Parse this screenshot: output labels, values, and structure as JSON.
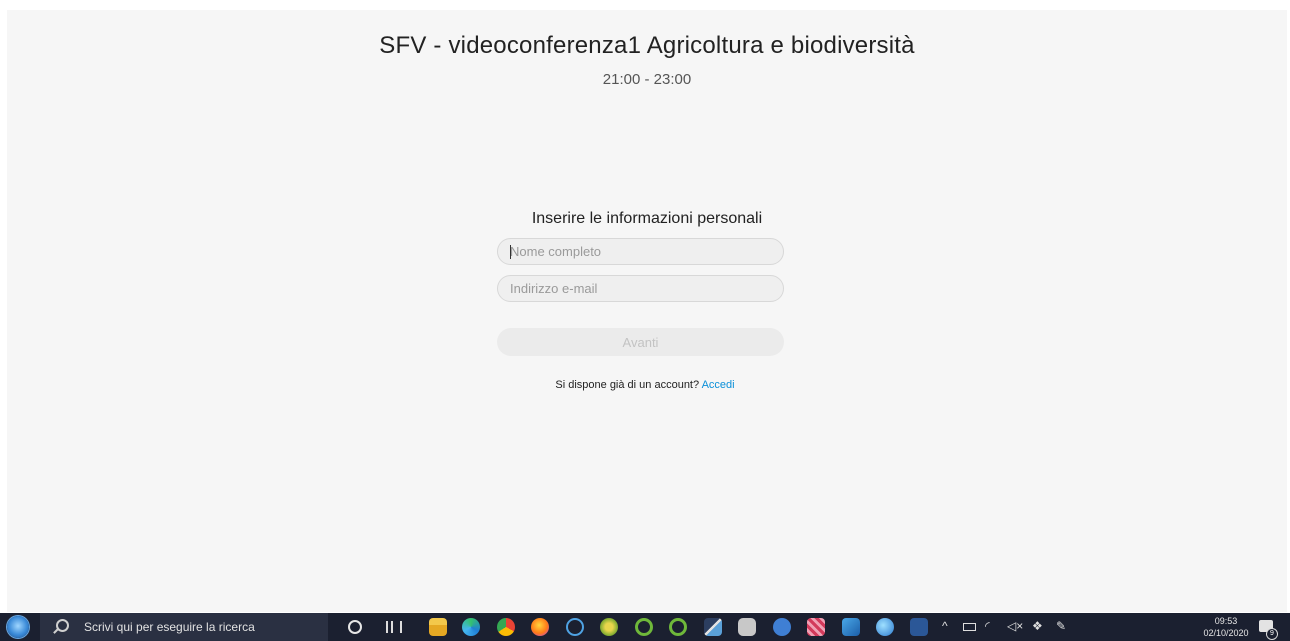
{
  "meeting": {
    "title": "SFV - videoconferenza1 Agricoltura e biodiversità",
    "time": "21:00 - 23:00"
  },
  "form": {
    "heading": "Inserire le informazioni personali",
    "name_placeholder": "Nome completo",
    "name_value": "",
    "email_placeholder": "Indirizzo e-mail",
    "email_value": "",
    "next_label": "Avanti",
    "account_prompt": "Si dispone già di un account?",
    "signin_link": "Accedi"
  },
  "taskbar": {
    "search_placeholder": "Scrivi qui per eseguire la ricerca",
    "pinned_icons": [
      "file-explorer-icon",
      "edge-icon",
      "chrome-icon",
      "firefox-icon",
      "network-icon",
      "qgis-icon",
      "qgis-icon-2",
      "qgis-icon-3",
      "chart-app-icon",
      "camera-app-icon",
      "r-icon",
      "game-icon",
      "paint-icon",
      "globe-icon",
      "word-icon"
    ],
    "clock": {
      "time": "09:53",
      "date": "02/10/2020"
    },
    "notification_count": "9"
  },
  "colors": {
    "page_bg": "#f6f6f6",
    "link": "#0a8fd8",
    "taskbar_bg": "#1b2030"
  }
}
